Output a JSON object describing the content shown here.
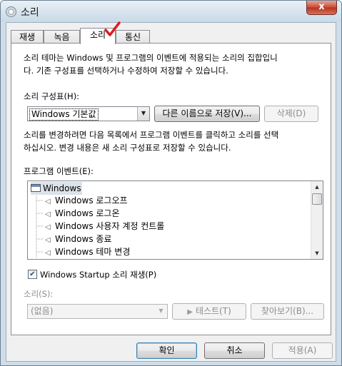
{
  "window": {
    "title": "소리",
    "close_label": "x"
  },
  "tabs": [
    {
      "label": "재생"
    },
    {
      "label": "녹음"
    },
    {
      "label": "소리"
    },
    {
      "label": "통신"
    }
  ],
  "active_tab": "소리",
  "description": {
    "line1": "소리 테마는 Windows 및 프로그램의 이벤트에 적용되는 소리의 집합입니",
    "line2": "다. 기존 구성표를 선택하거나 수정하여 저장할 수 있습니다."
  },
  "scheme": {
    "label": "소리 구성표(H):",
    "selected": "Windows 기본값",
    "save_as_label": "다른 이름으로 저장(V)...",
    "delete_label": "삭제(D)"
  },
  "instructions": {
    "line1": "소리를 변경하려면 다음 목록에서 프로그램 이벤트를 클릭하고 소리를 선택",
    "line2": "하십시오. 변경 내용은 새 소리 구성표로 저장할 수 있습니다."
  },
  "program_events": {
    "label": "프로그램 이벤트(E):",
    "root": "Windows",
    "items": [
      {
        "label": "Windows 로그오프"
      },
      {
        "label": "Windows 로그온"
      },
      {
        "label": "Windows 사용자 계정 컨트롤"
      },
      {
        "label": "Windows 종료"
      },
      {
        "label": "Windows 테마 변경"
      }
    ]
  },
  "startup_sound": {
    "label": "Windows Startup 소리 재생(P)",
    "checked": true
  },
  "sound": {
    "label": "소리(S):",
    "selected": "(없음)",
    "test_label": "테스트(T)",
    "browse_label": "찾아보기(B)..."
  },
  "footer": {
    "ok_label": "확인",
    "cancel_label": "취소",
    "apply_label": "적용(A)"
  },
  "colors": {
    "check_mark": "#e01b24",
    "tree_root_bg": "#dbe2ea"
  }
}
